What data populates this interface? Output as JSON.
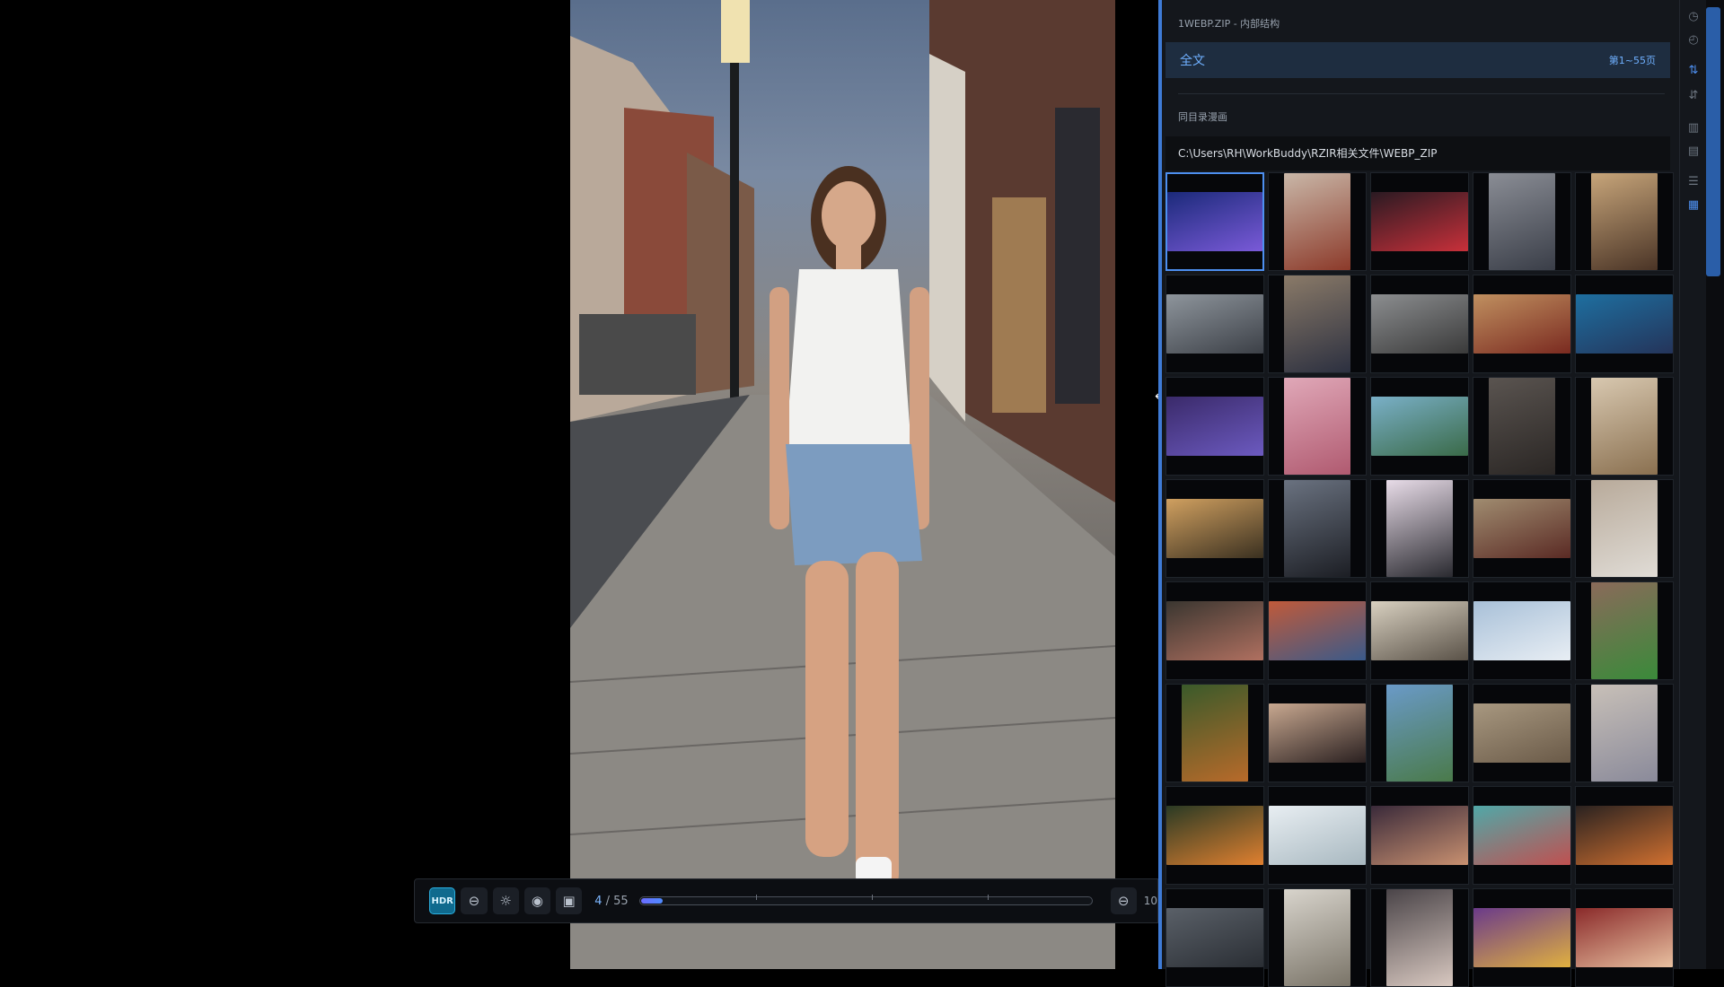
{
  "viewer": {
    "hdr_label": "HDR",
    "current_page": "4",
    "page_sep": " / ",
    "total_pages": "55",
    "progress": 0.047,
    "zoom_text": "10"
  },
  "sidebar": {
    "title": "1WEBP.ZIP - 内部结构",
    "tab_all": "全文",
    "page_range": "第1~55页",
    "section_label": "同目录漫画",
    "path": "C:\\Users\\RH\\WorkBuddy\\RZIR相关文件\\WEBP_ZIP",
    "selected_index": 0,
    "thumbnails": [
      {
        "shape": "wide",
        "c1": "#1b2a7a",
        "c2": "#7a5ad8"
      },
      {
        "shape": "tall",
        "c1": "#c9b7a8",
        "c2": "#8c3a2a"
      },
      {
        "shape": "wide",
        "c1": "#2a1a22",
        "c2": "#c8303a"
      },
      {
        "shape": "tall",
        "c1": "#8a8d95",
        "c2": "#3a3e48"
      },
      {
        "shape": "tall",
        "c1": "#c7a57a",
        "c2": "#4a3426"
      },
      {
        "shape": "wide",
        "c1": "#8e959c",
        "c2": "#3c4047"
      },
      {
        "shape": "tall",
        "c1": "#8a7a68",
        "c2": "#2c3040"
      },
      {
        "shape": "wide",
        "c1": "#8c8e90",
        "c2": "#3a3a3a"
      },
      {
        "shape": "wide",
        "c1": "#c09060",
        "c2": "#7a2a20"
      },
      {
        "shape": "wide",
        "c1": "#1e6fa0",
        "c2": "#24345a"
      },
      {
        "shape": "wide",
        "c1": "#3a2a6a",
        "c2": "#6c5ac0"
      },
      {
        "shape": "tall",
        "c1": "#e0a8b8",
        "c2": "#b05a70"
      },
      {
        "shape": "wide",
        "c1": "#7ab0c8",
        "c2": "#3a6a48"
      },
      {
        "shape": "tall",
        "c1": "#5a5450",
        "c2": "#2a2624"
      },
      {
        "shape": "tall",
        "c1": "#d8c8b0",
        "c2": "#8a7050"
      },
      {
        "shape": "wide",
        "c1": "#d0a060",
        "c2": "#3a3020"
      },
      {
        "shape": "tall",
        "c1": "#6a7280",
        "c2": "#1c1e24"
      },
      {
        "shape": "tall",
        "c1": "#e8dce8",
        "c2": "#2a2a30"
      },
      {
        "shape": "wide",
        "c1": "#a08c70",
        "c2": "#5a2a24"
      },
      {
        "shape": "tall",
        "c1": "#b8aa9a",
        "c2": "#e0dcd6"
      },
      {
        "shape": "wide",
        "c1": "#3a3630",
        "c2": "#b07060"
      },
      {
        "shape": "wide",
        "c1": "#c05a3a",
        "c2": "#3a5a8a"
      },
      {
        "shape": "wide",
        "c1": "#d8d0c0",
        "c2": "#5a5248"
      },
      {
        "shape": "wide",
        "c1": "#a8c0d8",
        "c2": "#e8eef4"
      },
      {
        "shape": "tall",
        "c1": "#8a6a5a",
        "c2": "#3a8a3a"
      },
      {
        "shape": "tall",
        "c1": "#3a5a2a",
        "c2": "#b86a2a"
      },
      {
        "shape": "wide",
        "c1": "#c8a890",
        "c2": "#2a2020"
      },
      {
        "shape": "tall",
        "c1": "#6a9ac8",
        "c2": "#4a7a4a"
      },
      {
        "shape": "wide",
        "c1": "#a89880",
        "c2": "#6a5a48"
      },
      {
        "shape": "tall",
        "c1": "#c8c0b8",
        "c2": "#8a8a9a"
      },
      {
        "shape": "wide",
        "c1": "#2a3a24",
        "c2": "#e08030"
      },
      {
        "shape": "wide",
        "c1": "#e8eef2",
        "c2": "#a8b8c0"
      },
      {
        "shape": "wide",
        "c1": "#3a2a3a",
        "c2": "#c89070"
      },
      {
        "shape": "wide",
        "c1": "#50a8a8",
        "c2": "#c05050"
      },
      {
        "shape": "wide",
        "c1": "#2a2220",
        "c2": "#d07030"
      },
      {
        "shape": "wide",
        "c1": "#5a6068",
        "c2": "#2a2e34"
      },
      {
        "shape": "tall",
        "c1": "#d8d4cc",
        "c2": "#7a7468"
      },
      {
        "shape": "tall",
        "c1": "#4a4448",
        "c2": "#d8c8c0"
      },
      {
        "shape": "wide",
        "c1": "#6a3a8a",
        "c2": "#e0b040"
      },
      {
        "shape": "wide",
        "c1": "#8a2a2a",
        "c2": "#e8c0a0"
      }
    ]
  },
  "rail_icons": [
    "clock-icon",
    "history-icon",
    "sort-asc-icon",
    "sort-desc-icon",
    "chart-icon",
    "bar-chart-icon",
    "list-view-icon",
    "grid-view-icon"
  ],
  "colors": {
    "accent": "#4d8ff0",
    "hdr": "#0f6a8e",
    "sidebar_bg": "#14171c"
  }
}
